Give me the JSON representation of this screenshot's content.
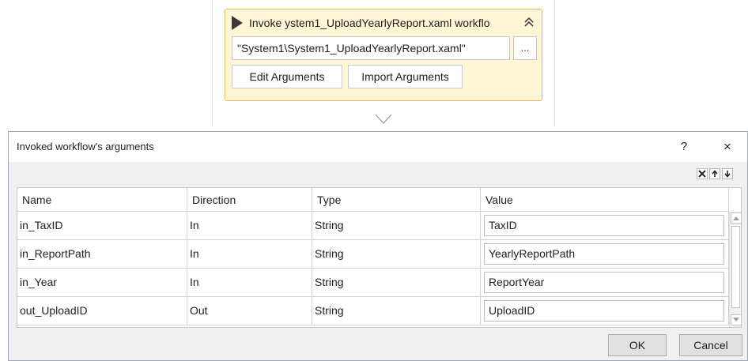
{
  "activity": {
    "title": "Invoke ystem1_UploadYearlyReport.xaml workflo",
    "workflow_path": "\"System1\\System1_UploadYearlyReport.xaml\"",
    "browse_label": "...",
    "edit_arguments_label": "Edit Arguments",
    "import_arguments_label": "Import Arguments",
    "border_color": "#e6b85a",
    "background_color": "#fff6d6"
  },
  "dialog": {
    "title": "Invoked workflow's arguments",
    "help_label": "?",
    "close_label": "×",
    "toolbar_icons": [
      "delete-icon",
      "move-up-icon",
      "move-down-icon"
    ],
    "columns": [
      "Name",
      "Direction",
      "Type",
      "Value"
    ],
    "rows": [
      {
        "name": "in_TaxID",
        "direction": "In",
        "type": "String",
        "value": "TaxID"
      },
      {
        "name": "in_ReportPath",
        "direction": "In",
        "type": "String",
        "value": "YearlyReportPath"
      },
      {
        "name": "in_Year",
        "direction": "In",
        "type": "String",
        "value": "ReportYear"
      },
      {
        "name": "out_UploadID",
        "direction": "Out",
        "type": "String",
        "value": "UploadID"
      }
    ],
    "ok_label": "OK",
    "cancel_label": "Cancel"
  }
}
